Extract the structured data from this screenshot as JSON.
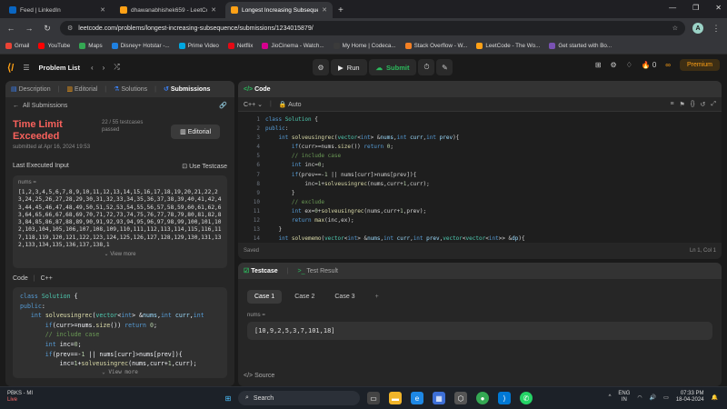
{
  "browser": {
    "tabs": [
      {
        "label": "Feed | LinkedIn",
        "fav_color": "#0a66c2",
        "active": false
      },
      {
        "label": "dhawanabhishek659 - LeetCo",
        "fav_color": "#ffa116",
        "active": false
      },
      {
        "label": "Longest Increasing Subseque",
        "fav_color": "#ffa116",
        "active": true
      }
    ],
    "url": "leetcode.com/problems/longest-increasing-subsequence/submissions/1234015879/",
    "profile_initial": "A",
    "bookmarks": [
      {
        "label": "Gmail",
        "color": "#ea4335"
      },
      {
        "label": "YouTube",
        "color": "#ff0000"
      },
      {
        "label": "Maps",
        "color": "#34a853"
      },
      {
        "label": "Disney+ Hotstar -...",
        "color": "#1f80e0"
      },
      {
        "label": "Prime Video",
        "color": "#00a8e1"
      },
      {
        "label": "Netflix",
        "color": "#e50914"
      },
      {
        "label": "JioCinema - Watch...",
        "color": "#d6008f"
      },
      {
        "label": "My Home | Codeca...",
        "color": "#3b3b3b"
      },
      {
        "label": "Stack Overflow - W...",
        "color": "#f48024"
      },
      {
        "label": "LeetCode - The Wo...",
        "color": "#ffa116"
      },
      {
        "label": "Get started with Bo...",
        "color": "#7952b3"
      }
    ]
  },
  "lcnav": {
    "problem_list": "Problem List",
    "run": "Run",
    "submit": "Submit",
    "streak": "0",
    "premium": "Premium"
  },
  "left": {
    "tabs": [
      "Description",
      "Editorial",
      "Solutions",
      "Submissions"
    ],
    "all_submissions": "All Submissions",
    "status": "Time Limit Exceeded",
    "testcases": "22 / 55 testcases passed",
    "submitted": "submitted at Apr 16, 2024 19:53",
    "editorial_btn": "Editorial",
    "last_input_label": "Last Executed Input",
    "use_testcase": "Use Testcase",
    "nums_label": "nums =",
    "nums_value": "[1,2,3,4,5,6,7,8,9,10,11,12,13,14,15,16,17,18,19,20,21,22,23,24,25,26,27,28,29,30,31,32,33,34,35,36,37,38,39,40,41,42,43,44,45,46,47,48,49,50,51,52,53,54,55,56,57,58,59,60,61,62,63,64,65,66,67,68,69,70,71,72,73,74,75,76,77,78,79,80,81,82,83,84,85,86,87,88,89,90,91,92,93,94,95,96,97,98,99,100,101,102,103,104,105,106,107,108,109,110,111,112,113,114,115,116,117,118,119,120,121,122,123,124,125,126,127,128,129,130,131,132,133,134,135,136,137,138,1",
    "view_more": "View more",
    "code_label": "Code",
    "code_lang": "C++",
    "code_view_more": "View more"
  },
  "code": {
    "title": "Code",
    "lang": "C++",
    "auto": "Auto",
    "saved": "Saved",
    "cursor": "Ln 1, Col 1"
  },
  "test": {
    "tab_testcase": "Testcase",
    "tab_result": "Test Result",
    "cases": [
      "Case 1",
      "Case 2",
      "Case 3"
    ],
    "nums_label": "nums =",
    "nums_value": "[10,9,2,5,3,7,101,18]",
    "source": "Source"
  },
  "taskbar": {
    "weather_title": "PBKS - MI",
    "weather_sub": "Live",
    "search": "Search",
    "lang1": "ENG",
    "lang2": "IN",
    "time": "07:33 PM",
    "date": "18-04-2024"
  }
}
